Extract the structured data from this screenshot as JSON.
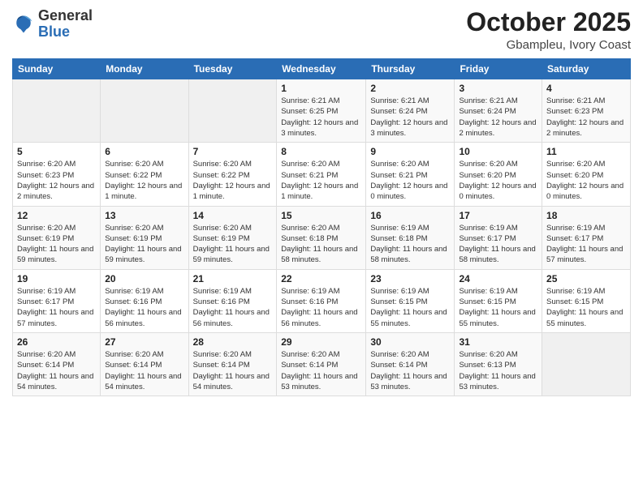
{
  "logo": {
    "general": "General",
    "blue": "Blue"
  },
  "title": {
    "month": "October 2025",
    "location": "Gbampleu, Ivory Coast"
  },
  "weekdays": [
    "Sunday",
    "Monday",
    "Tuesday",
    "Wednesday",
    "Thursday",
    "Friday",
    "Saturday"
  ],
  "weeks": [
    [
      {
        "day": "",
        "info": ""
      },
      {
        "day": "",
        "info": ""
      },
      {
        "day": "",
        "info": ""
      },
      {
        "day": "1",
        "info": "Sunrise: 6:21 AM\nSunset: 6:25 PM\nDaylight: 12 hours and 3 minutes."
      },
      {
        "day": "2",
        "info": "Sunrise: 6:21 AM\nSunset: 6:24 PM\nDaylight: 12 hours and 3 minutes."
      },
      {
        "day": "3",
        "info": "Sunrise: 6:21 AM\nSunset: 6:24 PM\nDaylight: 12 hours and 2 minutes."
      },
      {
        "day": "4",
        "info": "Sunrise: 6:21 AM\nSunset: 6:23 PM\nDaylight: 12 hours and 2 minutes."
      }
    ],
    [
      {
        "day": "5",
        "info": "Sunrise: 6:20 AM\nSunset: 6:23 PM\nDaylight: 12 hours and 2 minutes."
      },
      {
        "day": "6",
        "info": "Sunrise: 6:20 AM\nSunset: 6:22 PM\nDaylight: 12 hours and 1 minute."
      },
      {
        "day": "7",
        "info": "Sunrise: 6:20 AM\nSunset: 6:22 PM\nDaylight: 12 hours and 1 minute."
      },
      {
        "day": "8",
        "info": "Sunrise: 6:20 AM\nSunset: 6:21 PM\nDaylight: 12 hours and 1 minute."
      },
      {
        "day": "9",
        "info": "Sunrise: 6:20 AM\nSunset: 6:21 PM\nDaylight: 12 hours and 0 minutes."
      },
      {
        "day": "10",
        "info": "Sunrise: 6:20 AM\nSunset: 6:20 PM\nDaylight: 12 hours and 0 minutes."
      },
      {
        "day": "11",
        "info": "Sunrise: 6:20 AM\nSunset: 6:20 PM\nDaylight: 12 hours and 0 minutes."
      }
    ],
    [
      {
        "day": "12",
        "info": "Sunrise: 6:20 AM\nSunset: 6:19 PM\nDaylight: 11 hours and 59 minutes."
      },
      {
        "day": "13",
        "info": "Sunrise: 6:20 AM\nSunset: 6:19 PM\nDaylight: 11 hours and 59 minutes."
      },
      {
        "day": "14",
        "info": "Sunrise: 6:20 AM\nSunset: 6:19 PM\nDaylight: 11 hours and 59 minutes."
      },
      {
        "day": "15",
        "info": "Sunrise: 6:20 AM\nSunset: 6:18 PM\nDaylight: 11 hours and 58 minutes."
      },
      {
        "day": "16",
        "info": "Sunrise: 6:19 AM\nSunset: 6:18 PM\nDaylight: 11 hours and 58 minutes."
      },
      {
        "day": "17",
        "info": "Sunrise: 6:19 AM\nSunset: 6:17 PM\nDaylight: 11 hours and 58 minutes."
      },
      {
        "day": "18",
        "info": "Sunrise: 6:19 AM\nSunset: 6:17 PM\nDaylight: 11 hours and 57 minutes."
      }
    ],
    [
      {
        "day": "19",
        "info": "Sunrise: 6:19 AM\nSunset: 6:17 PM\nDaylight: 11 hours and 57 minutes."
      },
      {
        "day": "20",
        "info": "Sunrise: 6:19 AM\nSunset: 6:16 PM\nDaylight: 11 hours and 56 minutes."
      },
      {
        "day": "21",
        "info": "Sunrise: 6:19 AM\nSunset: 6:16 PM\nDaylight: 11 hours and 56 minutes."
      },
      {
        "day": "22",
        "info": "Sunrise: 6:19 AM\nSunset: 6:16 PM\nDaylight: 11 hours and 56 minutes."
      },
      {
        "day": "23",
        "info": "Sunrise: 6:19 AM\nSunset: 6:15 PM\nDaylight: 11 hours and 55 minutes."
      },
      {
        "day": "24",
        "info": "Sunrise: 6:19 AM\nSunset: 6:15 PM\nDaylight: 11 hours and 55 minutes."
      },
      {
        "day": "25",
        "info": "Sunrise: 6:19 AM\nSunset: 6:15 PM\nDaylight: 11 hours and 55 minutes."
      }
    ],
    [
      {
        "day": "26",
        "info": "Sunrise: 6:20 AM\nSunset: 6:14 PM\nDaylight: 11 hours and 54 minutes."
      },
      {
        "day": "27",
        "info": "Sunrise: 6:20 AM\nSunset: 6:14 PM\nDaylight: 11 hours and 54 minutes."
      },
      {
        "day": "28",
        "info": "Sunrise: 6:20 AM\nSunset: 6:14 PM\nDaylight: 11 hours and 54 minutes."
      },
      {
        "day": "29",
        "info": "Sunrise: 6:20 AM\nSunset: 6:14 PM\nDaylight: 11 hours and 53 minutes."
      },
      {
        "day": "30",
        "info": "Sunrise: 6:20 AM\nSunset: 6:14 PM\nDaylight: 11 hours and 53 minutes."
      },
      {
        "day": "31",
        "info": "Sunrise: 6:20 AM\nSunset: 6:13 PM\nDaylight: 11 hours and 53 minutes."
      },
      {
        "day": "",
        "info": ""
      }
    ]
  ]
}
